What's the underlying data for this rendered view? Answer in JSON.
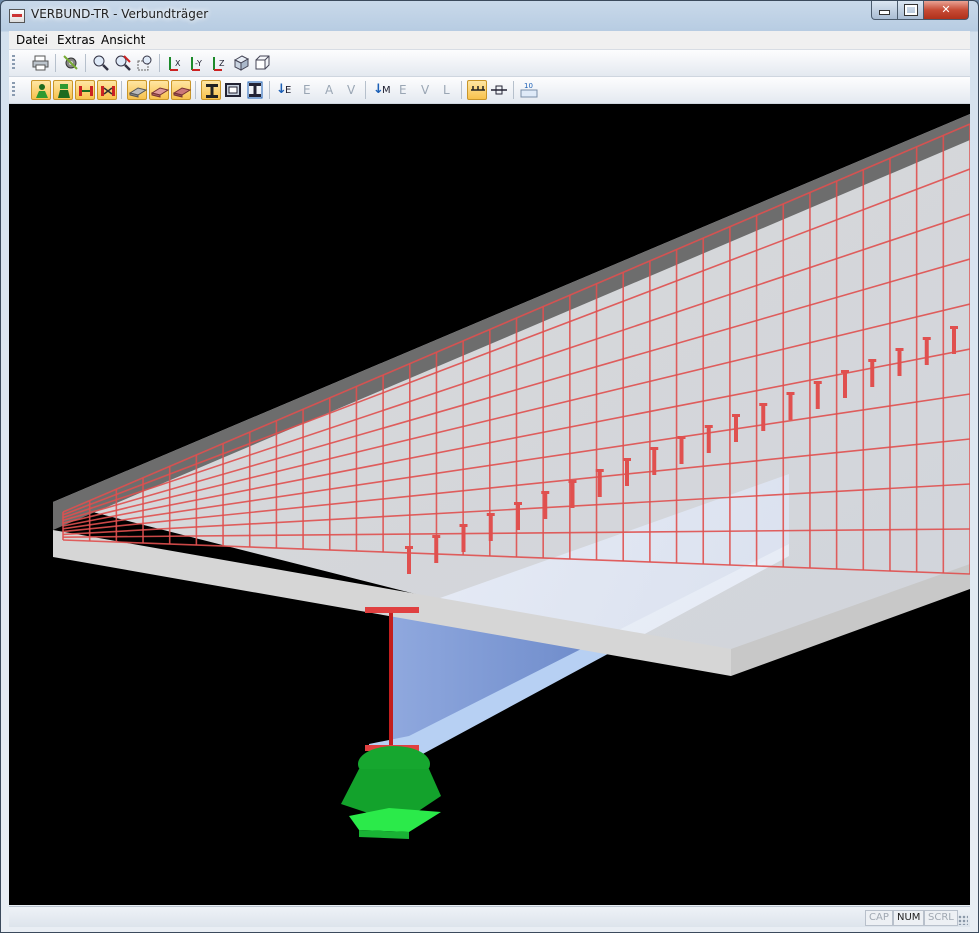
{
  "window": {
    "title": "VERBUND-TR - Verbundträger",
    "controls": {
      "minimize": "minimize",
      "maximize": "maximize",
      "close": "✕"
    }
  },
  "menu": {
    "items": [
      {
        "id": "datei",
        "label": "Datei"
      },
      {
        "id": "extras",
        "label": "Extras"
      },
      {
        "id": "ansicht",
        "label": "Ansicht"
      }
    ]
  },
  "toolbar2": {
    "result_E": "E",
    "letters_E": [
      "E",
      "A",
      "V"
    ],
    "result_M": "M",
    "letters_M": [
      "E",
      "V",
      "L"
    ],
    "scale_label": "10"
  },
  "toolbar1": {
    "view_labels": [
      "X",
      "-Y",
      "Z"
    ]
  },
  "status": {
    "cap": "CAP",
    "num": "NUM",
    "scrl": "SCRL"
  },
  "colors": {
    "viewport_bg": "#000000",
    "reinforcement": "#e0504f",
    "steel_beam": "#5b7fc6",
    "support": "#12a22e",
    "support_plate": "#2ee24a"
  }
}
